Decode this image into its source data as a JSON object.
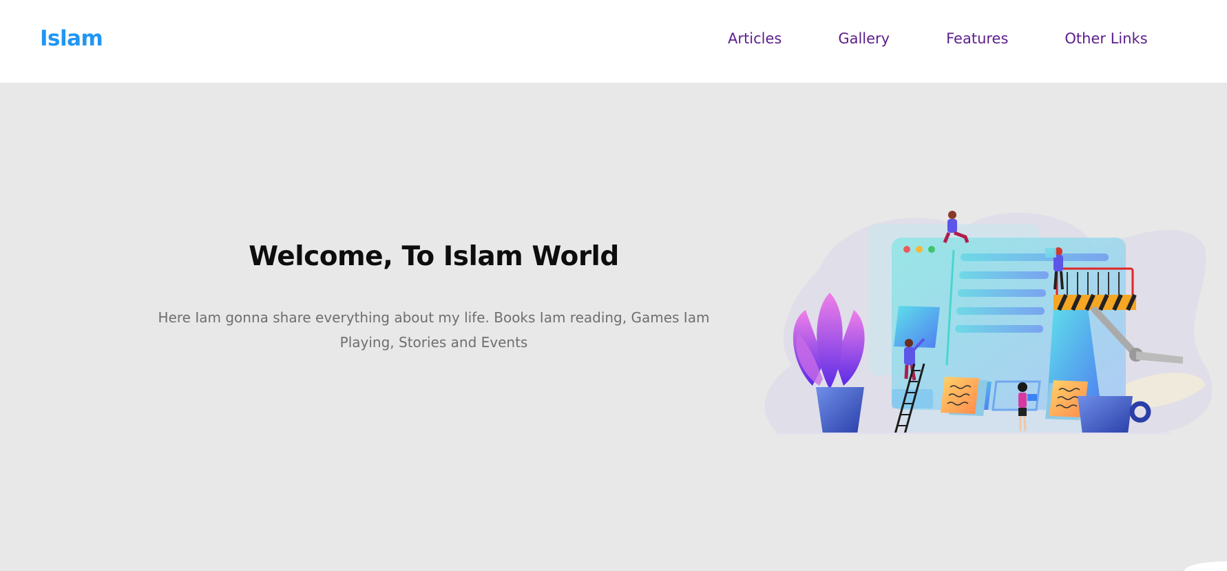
{
  "header": {
    "logo": "Islam",
    "nav": [
      {
        "label": "Articles"
      },
      {
        "label": "Gallery"
      },
      {
        "label": "Features"
      },
      {
        "label": "Other Links"
      }
    ]
  },
  "hero": {
    "title": "Welcome, To Islam World",
    "text": "Here Iam gonna share everything about my life. Books Iam reading, Games Iam Playing, Stories and Events"
  },
  "colors": {
    "logo": "#2196f3",
    "nav_link": "#5b1d8c",
    "hero_background": "#e8e8e8",
    "hero_title": "#0d0d0d",
    "hero_text": "#6e6e6e"
  },
  "illustration": "team-building-webpage-illustration"
}
